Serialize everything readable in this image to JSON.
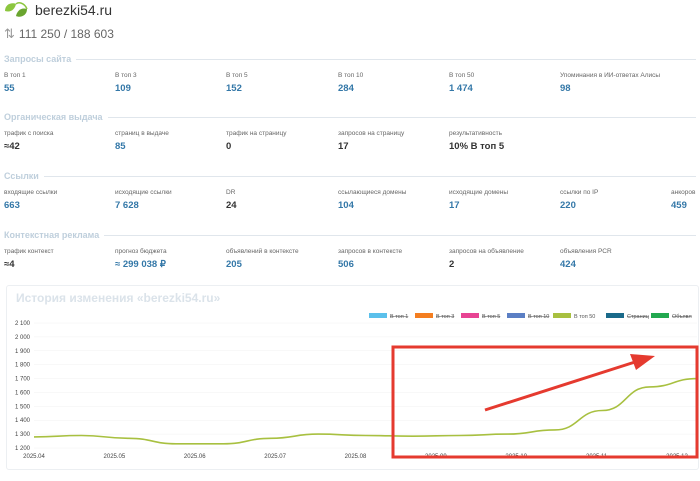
{
  "header": {
    "site": "berezki54.ru",
    "stats": "111 250 / 188 603",
    "arrows": "⇅"
  },
  "sections": {
    "queries": {
      "title": "Запросы сайта",
      "metrics": [
        {
          "label": "В топ 1",
          "value": "55",
          "link": true
        },
        {
          "label": "В топ 3",
          "value": "109",
          "link": true
        },
        {
          "label": "В топ 5",
          "value": "152",
          "link": true
        },
        {
          "label": "В топ 10",
          "value": "284",
          "link": true
        },
        {
          "label": "В топ 50",
          "value": "1 474",
          "link": true
        },
        {
          "label": "Упоминания в ИИ-ответах Алисы",
          "value": "98",
          "link": true
        }
      ]
    },
    "organic": {
      "title": "Органическая выдача",
      "metrics": [
        {
          "label": "трафик с поиска",
          "value": "≈42",
          "link": false
        },
        {
          "label": "страниц в выдаче",
          "value": "85",
          "link": true
        },
        {
          "label": "трафик на страницу",
          "value": "0",
          "link": false
        },
        {
          "label": "запросов на страницу",
          "value": "17",
          "link": false
        },
        {
          "label": "результативность",
          "value": "10% В топ 5",
          "link": false
        }
      ]
    },
    "links": {
      "title": "Ссылки",
      "metrics": [
        {
          "label": "входящие ссылки",
          "value": "663",
          "link": true
        },
        {
          "label": "исходящие ссылки",
          "value": "7 628",
          "link": true
        },
        {
          "label": "DR",
          "value": "24",
          "link": false
        },
        {
          "label": "ссылающиеся домены",
          "value": "104",
          "link": true
        },
        {
          "label": "исходящие домены",
          "value": "17",
          "link": true
        },
        {
          "label": "ссылки по IP",
          "value": "220",
          "link": true
        },
        {
          "label": "анкоров",
          "value": "459",
          "link": true
        }
      ]
    },
    "context": {
      "title": "Контекстная реклама",
      "metrics": [
        {
          "label": "трафик контекст",
          "value": "≈4",
          "link": false
        },
        {
          "label": "прогноз бюджета",
          "value": "≈ 299 038 ₽",
          "link": true
        },
        {
          "label": "объявлений в контексте",
          "value": "205",
          "link": true
        },
        {
          "label": "запросов в контексте",
          "value": "506",
          "link": true
        },
        {
          "label": "запросов на объявление",
          "value": "2",
          "link": false
        },
        {
          "label": "объявления PCR",
          "value": "424",
          "link": true
        }
      ]
    }
  },
  "chart_title": "История изменения «berezki54.ru»",
  "colors": {
    "accent": "#3478a8",
    "section_title": "#bfcfdc",
    "highlight": "#e53a2f",
    "series": "#a8c040"
  },
  "chart_data": {
    "type": "line",
    "title": "История изменения «berezki54.ru»",
    "x": [
      "2025.04",
      "2025.05",
      "2025.06",
      "2025.07",
      "2025.08",
      "2025.09",
      "2025.10",
      "2025.11",
      "2025.12"
    ],
    "ylim": [
      1200,
      2100
    ],
    "yticks": [
      "1 200",
      "1 300",
      "1 400",
      "1 500",
      "1 600",
      "1 700",
      "1 800",
      "1 900",
      "2 000",
      "2 100"
    ],
    "legend_position": "top-right",
    "legend": [
      {
        "name": "В топ 1",
        "color": "#5bc0eb",
        "strike": true
      },
      {
        "name": "В топ 3",
        "color": "#f47e20",
        "strike": true
      },
      {
        "name": "В топ 5",
        "color": "#e84393",
        "strike": true
      },
      {
        "name": "В топ 10",
        "color": "#5b7fc4",
        "strike": true
      },
      {
        "name": "В топ 50",
        "color": "#a8c040",
        "strike": false
      },
      {
        "name": "Страниц",
        "color": "#1a6a8a",
        "strike": true
      },
      {
        "name": "Объявл",
        "color": "#22a84f",
        "strike": true
      }
    ],
    "series": [
      {
        "name": "В топ 50",
        "color": "#a8c040",
        "values": [
          1280,
          1290,
          1270,
          1230,
          1230,
          1270,
          1300,
          1290,
          1285,
          1290,
          1300,
          1330,
          1470,
          1640,
          1700
        ]
      }
    ]
  }
}
